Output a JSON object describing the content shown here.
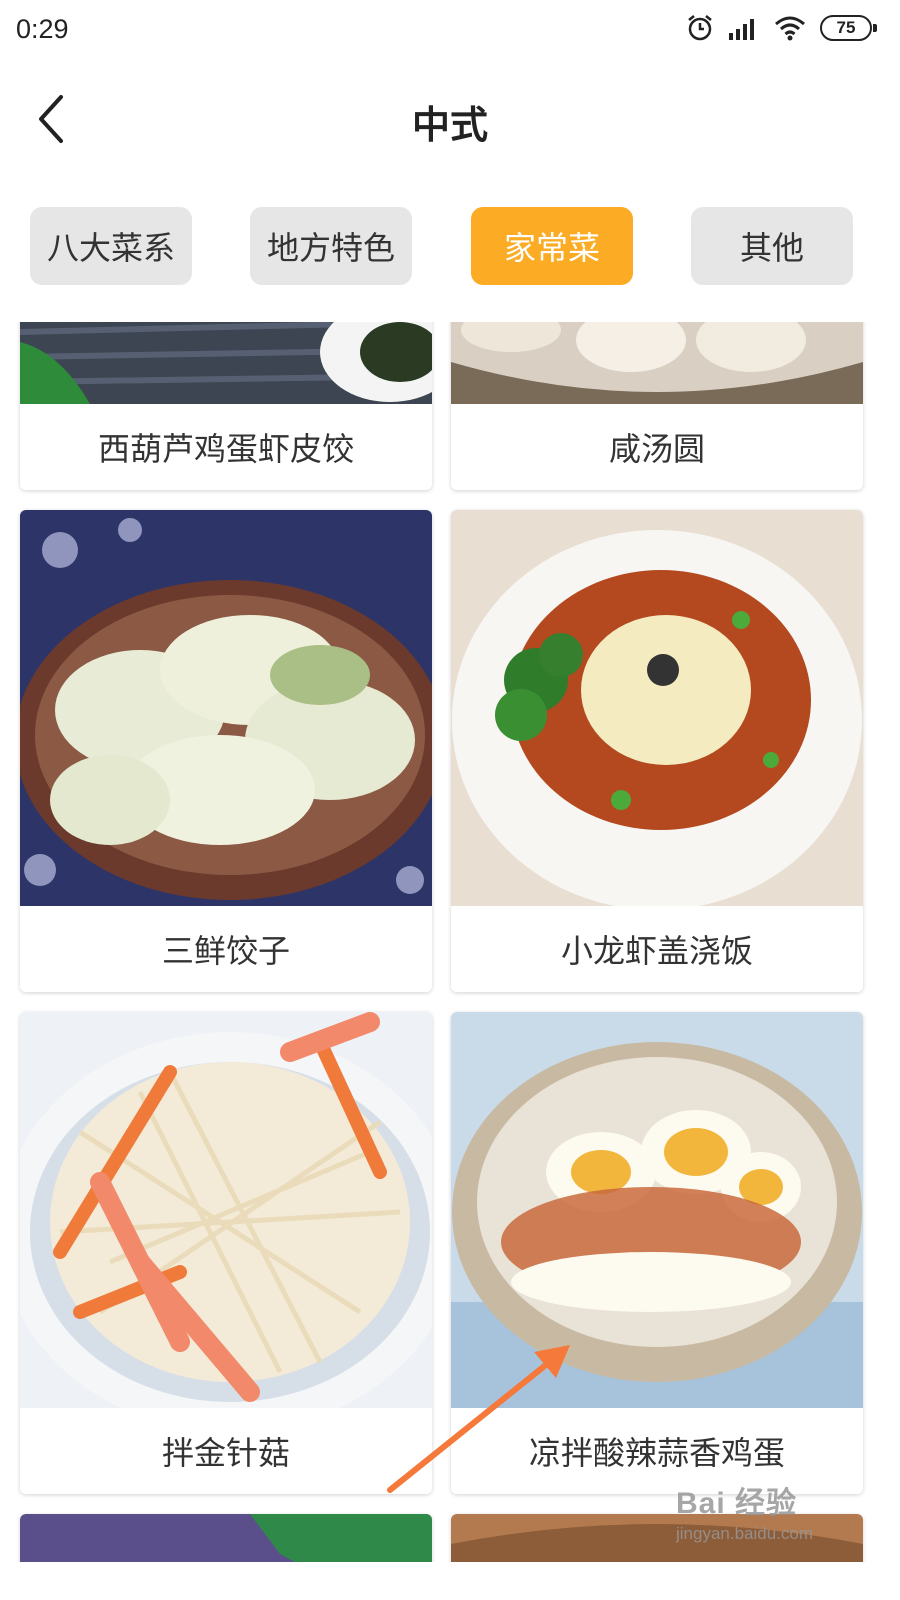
{
  "status_bar": {
    "time": "0:29",
    "battery": "75",
    "icons": [
      "alarm-icon",
      "signal-icon",
      "wifi-icon",
      "battery-icon"
    ]
  },
  "header": {
    "back_icon": "chevron-left-icon",
    "title": "中式"
  },
  "tabs": [
    {
      "label": "八大菜系",
      "active": false
    },
    {
      "label": "地方特色",
      "active": false
    },
    {
      "label": "家常菜",
      "active": true
    },
    {
      "label": "其他",
      "active": false
    }
  ],
  "colors": {
    "accent": "#fbab24",
    "tab_inactive": "#e6e6e6",
    "arrow": "#f5793a"
  },
  "dishes": [
    {
      "name": "西葫芦鸡蛋虾皮饺"
    },
    {
      "name": "咸汤圆"
    },
    {
      "name": "三鲜饺子"
    },
    {
      "name": "小龙虾盖浇饭"
    },
    {
      "name": "拌金针菇"
    },
    {
      "name": "凉拌酸辣蒜香鸡蛋"
    }
  ],
  "watermark": {
    "brand": "Bai 经验",
    "url": "jingyan.baidu.com"
  }
}
